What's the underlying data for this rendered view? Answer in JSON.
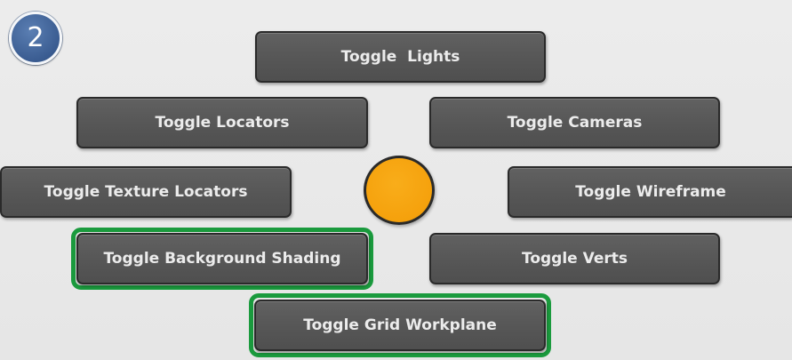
{
  "step_badge": {
    "number": "2"
  },
  "marking_menu": {
    "north": "Toggle  Lights",
    "north_west": "Toggle Locators",
    "north_east": "Toggle Cameras",
    "west": "Toggle Texture Locators",
    "east": "Toggle Wireframe",
    "south_west": "Toggle Background Shading",
    "south_east": "Toggle Verts",
    "south": "Toggle Grid Workplane"
  },
  "colors": {
    "button_face": "#575757",
    "button_text": "#ececec",
    "center_marker": "#f5a10c",
    "highlight": "#1a9a3d",
    "badge": "#3a5c91"
  }
}
